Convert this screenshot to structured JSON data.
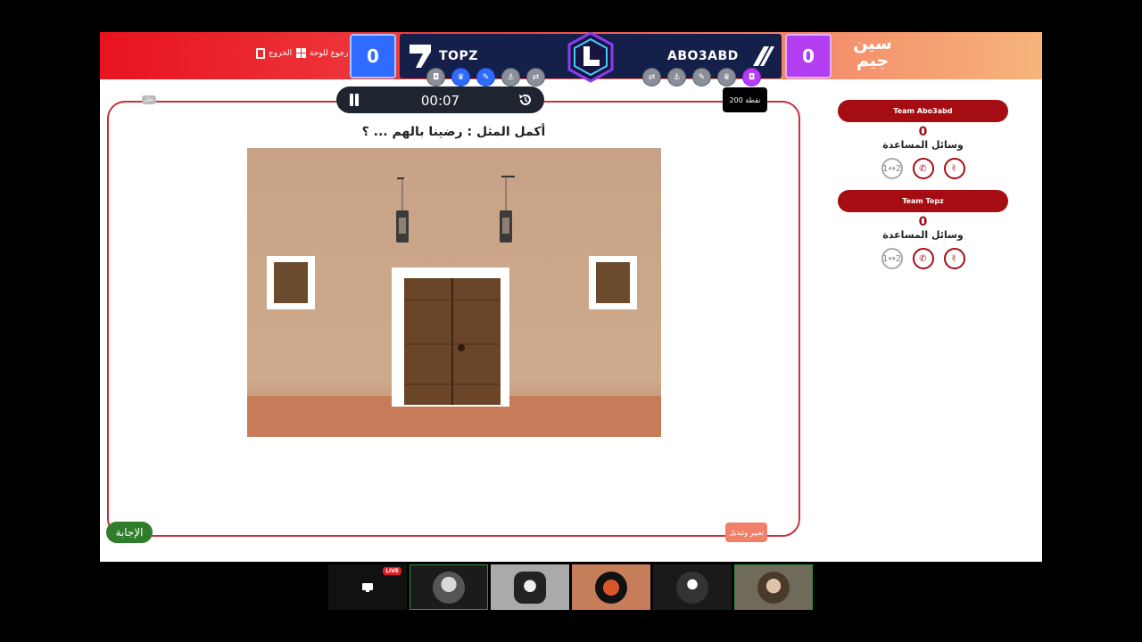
{
  "brand": {
    "logo_text_line1": "سين",
    "logo_text_line2": "جيم"
  },
  "nav": {
    "back_label": "رجوع للوحة",
    "exit_label": "الخروج"
  },
  "teams": {
    "left": {
      "name": "TOPZ",
      "score": "0",
      "color": "#2f6bff"
    },
    "right": {
      "name": "ABO3ABD",
      "score": "0",
      "color": "#b33df0"
    }
  },
  "powerups_left": [
    "car-icon",
    "trophy-icon",
    "mic-icon",
    "anchor-icon",
    "swap-icon"
  ],
  "powerups_right": [
    "swap-icon",
    "anchor-icon",
    "mic-icon",
    "trophy-icon",
    "car-icon"
  ],
  "timer": {
    "time": "00:07"
  },
  "points_badge": "200 نقطة",
  "question": {
    "text": "أكمل المثل : رضينا بالهم ... ؟"
  },
  "answer_button": "الإجابة",
  "side_button": "تغيير وتبديل",
  "corner_label": "مثل",
  "panels": [
    {
      "team_label": "Team Abo3abd",
      "score": "0",
      "helpers_label": "وسائل المساعدة",
      "helpers": [
        {
          "name": "peace-icon",
          "state": "active"
        },
        {
          "name": "phone-icon",
          "state": "active"
        },
        {
          "name": "swap-12-icon",
          "state": "disabled"
        }
      ]
    },
    {
      "team_label": "Team Topz",
      "score": "0",
      "helpers_label": "وسائل المساعدة",
      "helpers": [
        {
          "name": "peace-icon",
          "state": "active"
        },
        {
          "name": "phone-icon",
          "state": "active"
        },
        {
          "name": "swap-12-icon",
          "state": "disabled"
        }
      ]
    }
  ],
  "video_strip": {
    "live_badge": "LIVE"
  },
  "colors": {
    "accent_red": "#a50d12",
    "frame_red": "#c8313f",
    "answer_green": "#2f7d2a"
  }
}
